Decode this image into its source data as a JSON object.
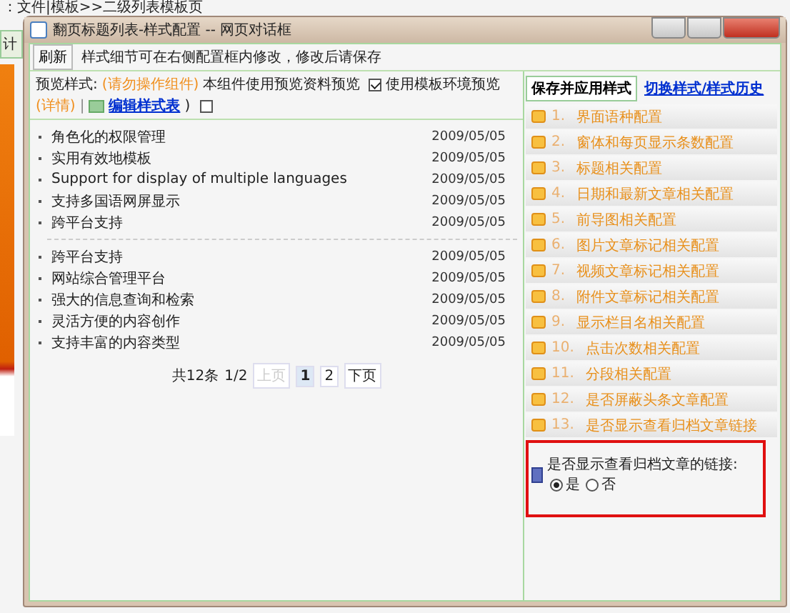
{
  "background": {
    "breadcrumb": "：文件|模板>>二级列表模板页",
    "side_tab": "计"
  },
  "window": {
    "title": "翻页标题列表-样式配置 -- 网页对话框"
  },
  "toolbar": {
    "refresh": "刷新",
    "hint": "样式细节可在右侧配置框内修改，修改后请保存"
  },
  "preview_bar": {
    "label": "预览样式:",
    "warning": "(请勿操作组件)",
    "note": "本组件使用预览资料预览",
    "template_option": {
      "label": "使用模板环境预览",
      "checked": true
    },
    "details": "(详情)",
    "separator": "|",
    "edit_link": "编辑样式表",
    "close_paren": ")",
    "extra_checkbox": {
      "checked": false
    }
  },
  "article_groups": [
    [
      {
        "title": "角色化的权限管理",
        "date": "2009/05/05"
      },
      {
        "title": "实用有效地模板",
        "date": "2009/05/05"
      },
      {
        "title": "Support for display of multiple languages",
        "date": "2009/05/05"
      },
      {
        "title": "支持多国语网屏显示",
        "date": "2009/05/05"
      },
      {
        "title": "跨平台支持",
        "date": "2009/05/05"
      }
    ],
    [
      {
        "title": "跨平台支持",
        "date": "2009/05/05"
      },
      {
        "title": "网站综合管理平台",
        "date": "2009/05/05"
      },
      {
        "title": "强大的信息查询和检索",
        "date": "2009/05/05"
      },
      {
        "title": "灵活方便的内容创作",
        "date": "2009/05/05"
      },
      {
        "title": "支持丰富的内容类型",
        "date": "2009/05/05"
      }
    ]
  ],
  "pager": {
    "total": "共12条",
    "page": "1/2",
    "prev": {
      "label": "上页",
      "disabled": true
    },
    "pages": [
      {
        "label": "1",
        "selected": true
      },
      {
        "label": "2",
        "selected": false
      }
    ],
    "next": {
      "label": "下页",
      "disabled": false
    }
  },
  "config_panel": {
    "save_button": "保存并应用样式",
    "history_link": "切换样式/样式历史",
    "sections": [
      {
        "number": "1.",
        "label": "界面语种配置"
      },
      {
        "number": "2.",
        "label": "窗体和每页显示条数配置"
      },
      {
        "number": "3.",
        "label": "标题相关配置"
      },
      {
        "number": "4.",
        "label": "日期和最新文章相关配置"
      },
      {
        "number": "5.",
        "label": "前导图相关配置"
      },
      {
        "number": "6.",
        "label": "图片文章标记相关配置"
      },
      {
        "number": "7.",
        "label": "视频文章标记相关配置"
      },
      {
        "number": "8.",
        "label": "附件文章标记相关配置"
      },
      {
        "number": "9.",
        "label": "显示栏目名相关配置"
      },
      {
        "number": "10.",
        "label": "点击次数相关配置"
      },
      {
        "number": "11.",
        "label": "分段相关配置"
      },
      {
        "number": "12.",
        "label": "是否屏蔽头条文章配置"
      },
      {
        "number": "13.",
        "label": "是否显示查看归档文章链接"
      }
    ],
    "setting": {
      "question": "是否显示查看归档文章的链接:",
      "options": [
        {
          "label": "是",
          "selected": true
        },
        {
          "label": "否",
          "selected": false
        }
      ]
    }
  }
}
